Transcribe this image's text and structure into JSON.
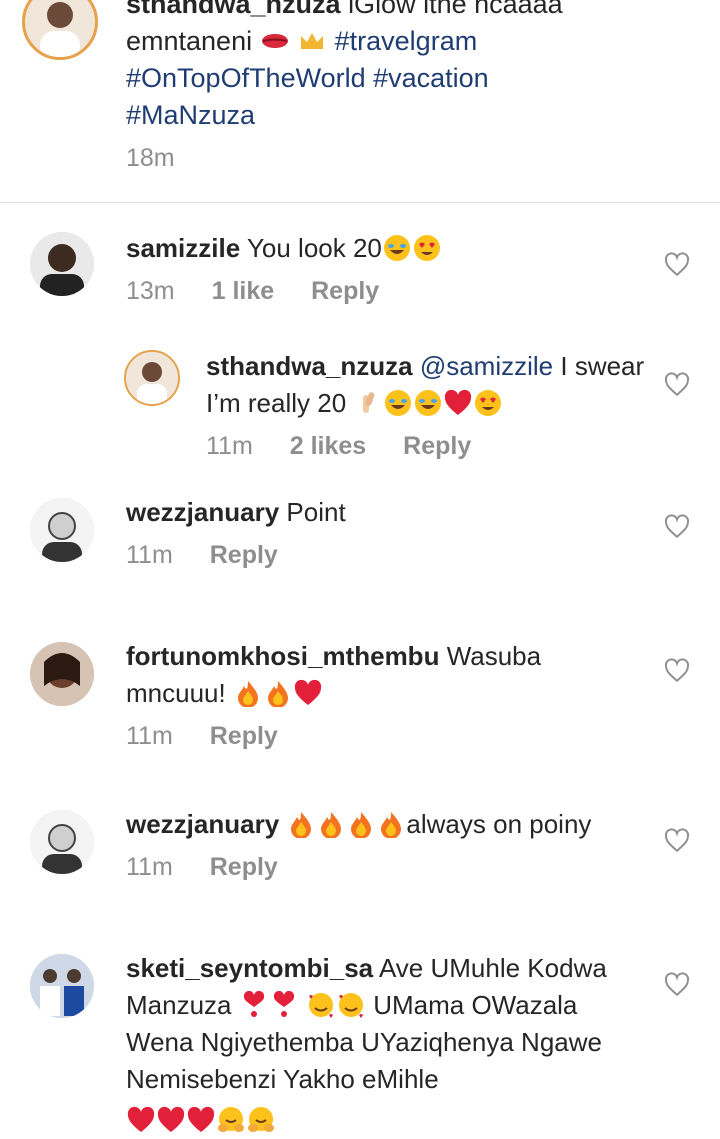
{
  "caption": {
    "username": "sthandwa_nzuza",
    "text": "iGlow ithe ncaaaa emntaneni",
    "emoji1": "lips-emoji",
    "emoji2": "crown-emoji",
    "hashtags": "#travelgram #OnTopOfTheWorld #vacation #MaNzuza",
    "time": "18m"
  },
  "comments": [
    {
      "username": "samizzile",
      "text": "You look 20",
      "time": "13m",
      "likes": "1 like",
      "reply": "Reply",
      "emojis": [
        "laughing-emoji",
        "heart-eyes-emoji"
      ]
    },
    {
      "username": "sthandwa_nzuza",
      "mention": "@samizzile",
      "text": "I swear I’m really 20",
      "time": "11m",
      "likes": "2 likes",
      "reply": "Reply",
      "emojis": [
        "crossed-fingers-emoji",
        "laughing-emoji",
        "laughing-emoji",
        "red-heart-emoji",
        "heart-eyes-emoji"
      ]
    },
    {
      "username": "wezzjanuary",
      "text": "Point",
      "time": "11m",
      "reply": "Reply"
    },
    {
      "username": "fortunomkhosi_mthembu",
      "text": "Wasuba mncuuu!",
      "time": "11m",
      "reply": "Reply",
      "emojis": [
        "fire-emoji",
        "fire-emoji",
        "red-heart-emoji"
      ]
    },
    {
      "username": "wezzjanuary",
      "text": "always on poiny",
      "time": "11m",
      "reply": "Reply",
      "emojis": [
        "fire-emoji",
        "fire-emoji",
        "fire-emoji",
        "fire-emoji"
      ]
    },
    {
      "username": "sketi_seyntombi_sa",
      "text1": "Ave UMuhle Kodwa Manzuza",
      "text2": "UMama OWazala Wena Ngiyethemba UYaziqhenya Ngawe Nemisebenzi Yakho eMihle",
      "emojis": [
        "heart-exclamation-emoji",
        "heart-exclamation-emoji",
        "smiling-hearts-emoji",
        "smiling-hearts-emoji"
      ],
      "emojis2": [
        "red-heart-emoji",
        "red-heart-emoji",
        "red-heart-emoji",
        "hugging-emoji",
        "hugging-emoji"
      ]
    }
  ]
}
